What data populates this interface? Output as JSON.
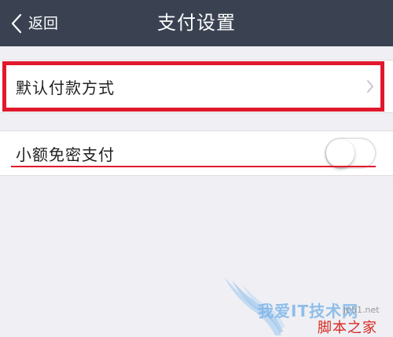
{
  "navbar": {
    "back_label": "返回",
    "title": "支付设置"
  },
  "settings": {
    "default_payment": {
      "label": "默认付款方式"
    },
    "small_amount_passwordless": {
      "label": "小额免密支付",
      "enabled": false
    }
  },
  "watermark": {
    "brand_text": "我爱IT技术网",
    "domain": "jb51.net",
    "site_name": "脚本之家"
  },
  "colors": {
    "navbar_bg": "#3a4252",
    "page_bg": "#efeff4",
    "highlight_red": "#e0192d",
    "watermark_blue": "#7fb6e8",
    "watermark_red": "#d8281e"
  },
  "icons": {
    "back": "chevron-left-icon",
    "row_chevron": "chevron-right-icon",
    "toggle": "toggle-switch-off"
  }
}
